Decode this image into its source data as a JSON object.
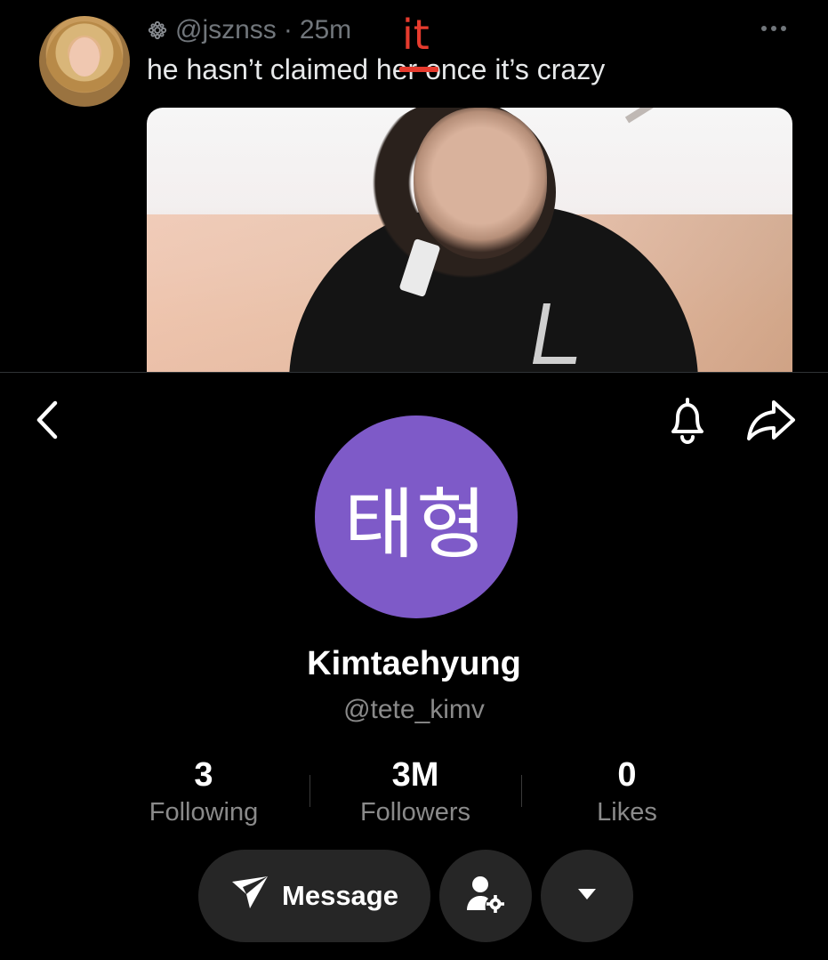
{
  "tweet": {
    "handle": "@jsznss",
    "separator": "·",
    "time": "25m",
    "text_before": "he hasn’t claimed ",
    "struck_word": "her",
    "text_after": " once it’s crazy",
    "annotation": "it",
    "annotation_color": "#e63b2e",
    "avatar_icon": "profile-photo",
    "more_icon": "more-dots-icon"
  },
  "profile": {
    "avatar_text": "태형",
    "avatar_color": "#7e5ac8",
    "name": "Kimtaehyung",
    "handle": "@tete_kimv",
    "stats": [
      {
        "value": "3",
        "label": "Following"
      },
      {
        "value": "3M",
        "label": "Followers"
      },
      {
        "value": "0",
        "label": "Likes"
      }
    ],
    "message_label": "Message",
    "icons": {
      "back": "chevron-left-icon",
      "bell": "bell-icon",
      "share": "share-arrow-icon",
      "send": "paper-plane-icon",
      "manage": "user-settings-icon",
      "more": "caret-down-icon"
    }
  }
}
